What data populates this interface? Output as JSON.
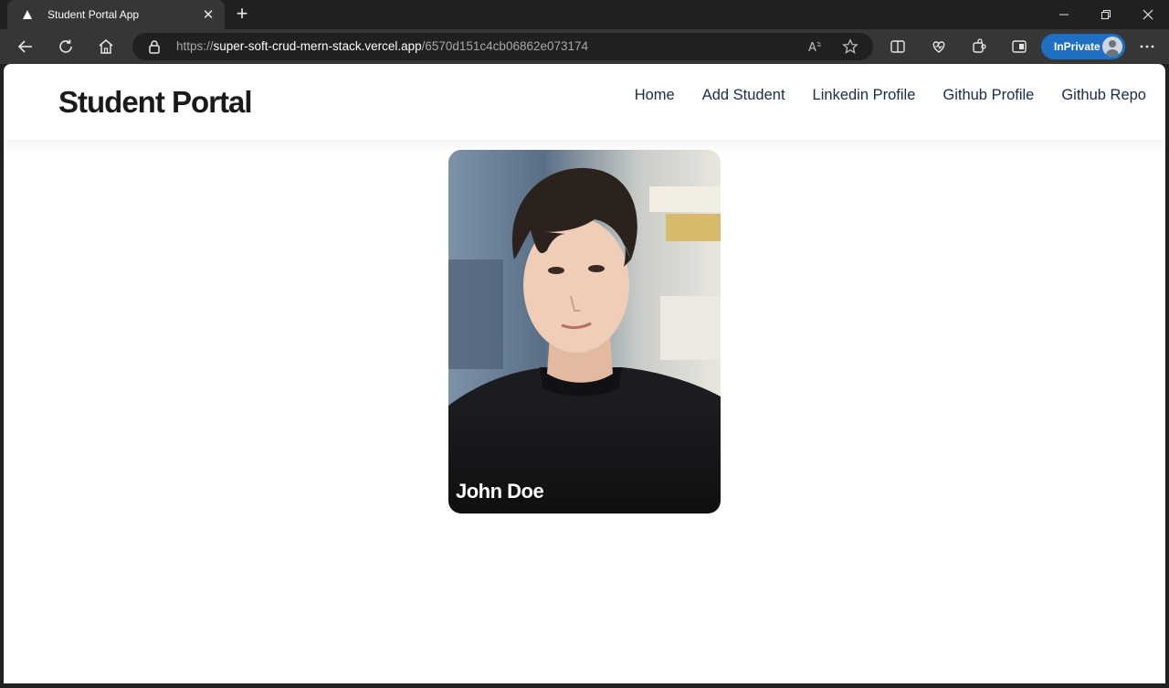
{
  "browser": {
    "tab_title": "Student Portal App",
    "url_scheme": "https://",
    "url_host": "super-soft-crud-mern-stack.vercel.app",
    "url_path": "/6570d151c4cb06862e073174",
    "inprivate_label": "InPrivate"
  },
  "site": {
    "brand": "Student Portal",
    "nav": [
      {
        "label": "Home"
      },
      {
        "label": "Add Student"
      },
      {
        "label": "Linkedin Profile"
      },
      {
        "label": "Github Profile"
      },
      {
        "label": "Github Repo"
      }
    ]
  },
  "student_card": {
    "name": "John Doe"
  },
  "colors": {
    "chrome_dark": "#202020",
    "chrome_toolbar": "#363636",
    "inprivate_blue": "#1f6fc5",
    "nav_link": "#1a2b4c"
  }
}
